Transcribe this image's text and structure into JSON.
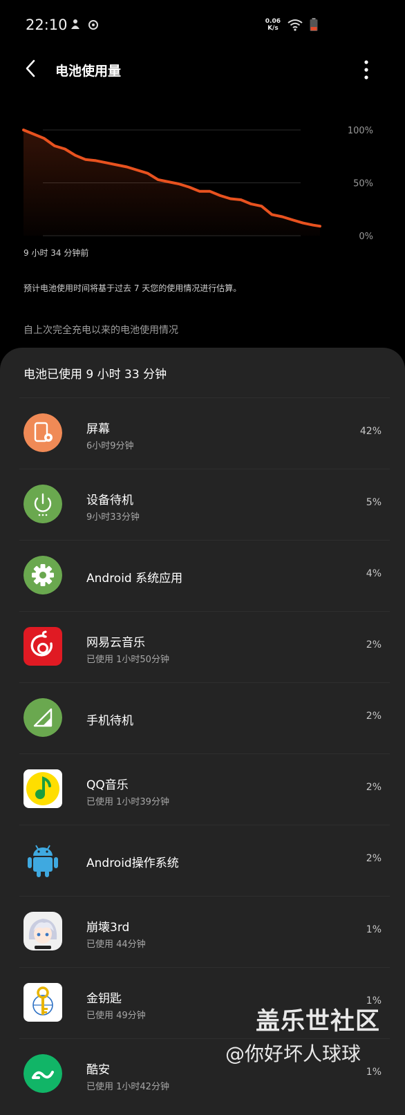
{
  "status": {
    "time": "22:10",
    "netspeed_value": "0.06",
    "netspeed_unit": "K/s"
  },
  "header": {
    "title": "电池使用量"
  },
  "chart_data": {
    "type": "area",
    "x": [
      0,
      2,
      4,
      6,
      8,
      10,
      12,
      14,
      16,
      18,
      20,
      22,
      24,
      26,
      28,
      30,
      32,
      34,
      36,
      38,
      40,
      42,
      44,
      46,
      48,
      50,
      52,
      54,
      56,
      57.3
    ],
    "values": [
      100,
      96,
      92,
      85,
      82,
      76,
      72,
      71,
      69,
      67,
      65,
      62,
      59,
      53,
      51,
      49,
      46,
      42,
      42,
      38,
      35,
      34,
      30,
      28,
      20,
      18,
      15,
      12,
      10,
      9
    ],
    "ytick_labels": [
      "100%",
      "50%",
      "0%"
    ],
    "ylim": [
      0,
      100
    ],
    "start_label": "9 小时 34 分钟前",
    "line_color": "#e8521f",
    "grid": true
  },
  "estimate_note": "预计电池使用时间将基于过去 7 天您的使用情况进行估算。",
  "since_label": "自上次完全充电以来的电池使用情况",
  "sheet": {
    "title": "电池已使用 9 小时 33 分钟",
    "apps": [
      {
        "name": "屏幕",
        "sub": "6小时9分钟",
        "pct": "42%",
        "icon": "screen-icon",
        "color": "#f08a56"
      },
      {
        "name": "设备待机",
        "sub": "9小时33分钟",
        "pct": "5%",
        "icon": "power-icon",
        "color": "#6aa84f"
      },
      {
        "name": "Android 系统应用",
        "sub": "",
        "pct": "4%",
        "icon": "gear-icon",
        "color": "#6aa84f"
      },
      {
        "name": "网易云音乐",
        "sub": "已使用 1小时50分钟",
        "pct": "2%",
        "icon": "netease-music-icon",
        "color": "#e01a23"
      },
      {
        "name": "手机待机",
        "sub": "",
        "pct": "2%",
        "icon": "signal-icon",
        "color": "#6aa84f"
      },
      {
        "name": "QQ音乐",
        "sub": "已使用 1小时39分钟",
        "pct": "2%",
        "icon": "qq-music-icon",
        "color": "#ffde00"
      },
      {
        "name": "Android操作系统",
        "sub": "",
        "pct": "2%",
        "icon": "android-icon",
        "color": "#3fa9e0"
      },
      {
        "name": "崩壊3rd",
        "sub": "已使用 44分钟",
        "pct": "1%",
        "icon": "honkai-icon",
        "color": "#f0f0f0"
      },
      {
        "name": "金钥匙",
        "sub": "已使用 49分钟",
        "pct": "1%",
        "icon": "golden-key-icon",
        "color": "#e8b400"
      },
      {
        "name": "酷安",
        "sub": "已使用 1小时42分钟",
        "pct": "1%",
        "icon": "coolapk-icon",
        "color": "#11b567"
      }
    ]
  },
  "watermark": {
    "line1": "盖乐世社区",
    "line2": "@你好坏人球球"
  }
}
